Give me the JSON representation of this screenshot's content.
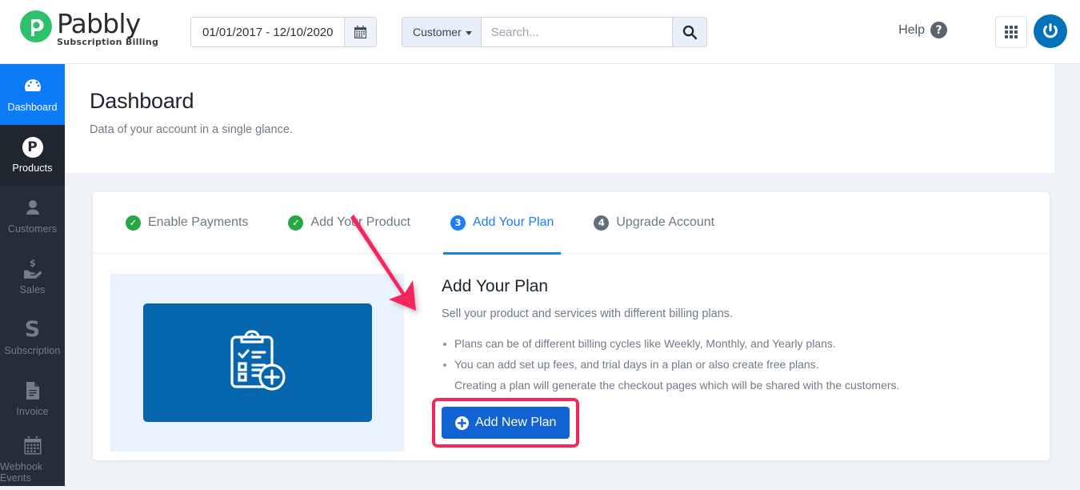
{
  "brand": {
    "name": "Pabbly",
    "tagline": "Subscription Billing",
    "logo_color": "#2ec16b"
  },
  "topbar": {
    "date_range": "01/01/2017 - 12/10/2020",
    "calendar_icon": "calendar-icon",
    "search_scope": "Customer",
    "search_placeholder": "Search...",
    "search_value": "",
    "search_icon": "search-icon",
    "help_label": "Help",
    "help_icon": "question-mark-icon",
    "apps_icon": "grid-apps-icon",
    "account_icon": "power-user-icon"
  },
  "sidebar": {
    "items": [
      {
        "label": "Dashboard",
        "icon": "speedometer-icon",
        "state": "active"
      },
      {
        "label": "Products",
        "icon": "p-circle-icon",
        "state": "current"
      },
      {
        "label": "Customers",
        "icon": "user-icon",
        "state": "normal"
      },
      {
        "label": "Sales",
        "icon": "hand-money-icon",
        "state": "normal"
      },
      {
        "label": "Subscription",
        "icon": "s-letter-icon",
        "state": "normal"
      },
      {
        "label": "Invoice",
        "icon": "document-icon",
        "state": "normal"
      },
      {
        "label": "Webhook Events",
        "icon": "calendar-icon",
        "state": "normal"
      }
    ]
  },
  "page": {
    "title": "Dashboard",
    "subtitle": "Data of your account in a single glance."
  },
  "tabs": [
    {
      "label": "Enable Payments",
      "badge": "✓",
      "state": "done"
    },
    {
      "label": "Add Your Product",
      "badge": "✓",
      "state": "done"
    },
    {
      "label": "Add Your Plan",
      "badge": "3",
      "state": "active"
    },
    {
      "label": "Upgrade Account",
      "badge": "4",
      "state": "todo"
    }
  ],
  "panel": {
    "illustration_icon": "clipboard-checklist-add-icon",
    "heading": "Add Your Plan",
    "lead": "Sell your product and services with different billing plans.",
    "bullets": [
      "Plans can be of different billing cycles like Weekly, Monthly, and Yearly plans.",
      "You can add set up fees, and trial days in a plan or also create free plans.",
      "Creating a plan will generate the checkout pages which will be shared with the customers."
    ],
    "cta_label": "Add New Plan",
    "cta_icon": "plus-circle-icon"
  },
  "annotation": {
    "highlight_color": "#f5255e",
    "arrow_icon": "pointer-arrow-icon"
  }
}
